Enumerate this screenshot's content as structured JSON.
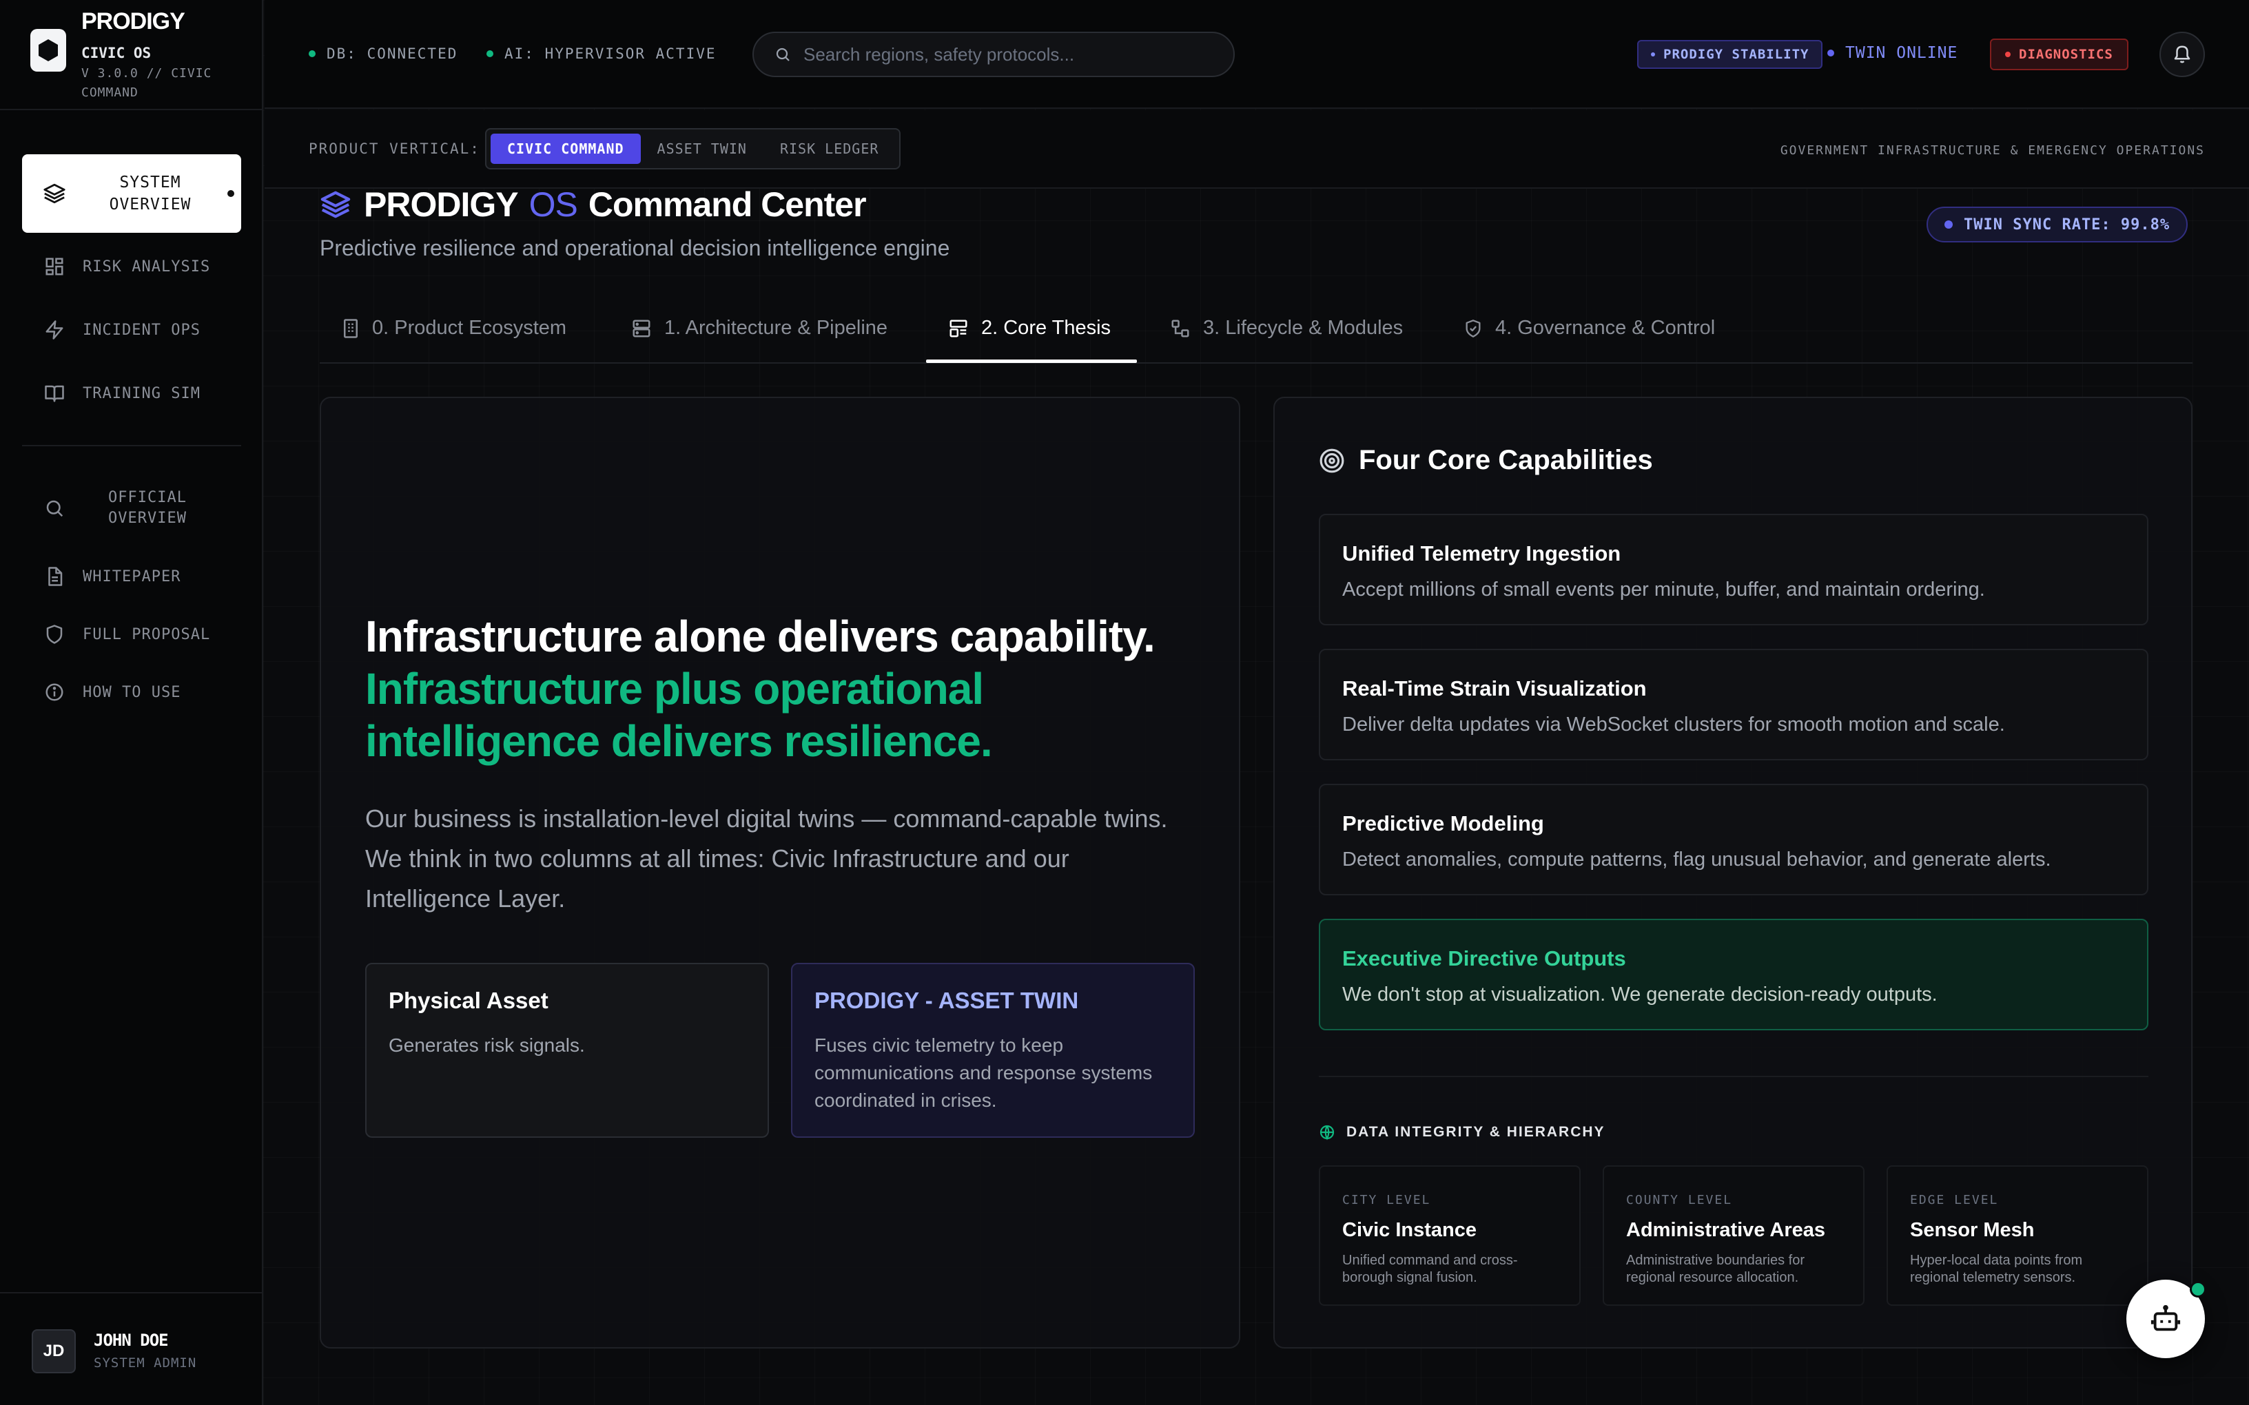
{
  "brand": {
    "name": "PRODIGY",
    "subtitle": "CIVIC OS",
    "version": "V 3.0.0 // CIVIC COMMAND"
  },
  "sidebar": {
    "active_item": {
      "label": "SYSTEM OVERVIEW",
      "icon": "layers-icon"
    },
    "items": [
      {
        "label": "RISK ANALYSIS",
        "icon": "grid-icon"
      },
      {
        "label": "INCIDENT OPS",
        "icon": "lightning-icon"
      },
      {
        "label": "TRAINING SIM",
        "icon": "book-icon"
      }
    ],
    "secondary_items": [
      {
        "label": "OFFICIAL OVERVIEW",
        "icon": "search-icon"
      },
      {
        "label": "WHITEPAPER",
        "icon": "document-icon"
      },
      {
        "label": "FULL PROPOSAL",
        "icon": "shield-icon"
      },
      {
        "label": "HOW TO USE",
        "icon": "info-icon"
      }
    ],
    "user": {
      "initials": "JD",
      "name": "JOHN DOE",
      "role": "SYSTEM ADMIN"
    }
  },
  "topbar": {
    "status_db": "DB: CONNECTED",
    "status_ai": "AI: HYPERVISOR ACTIVE",
    "search_placeholder": "Search regions, safety protocols...",
    "stability_label": "PRODIGY STABILITY",
    "twin_status": "TWIN ONLINE",
    "diagnostics_label": "DIAGNOSTICS",
    "colors": {
      "ok": "#10b981",
      "accent": "#6366f1",
      "danger": "#ef4444"
    }
  },
  "vertical_bar": {
    "label": "PRODUCT VERTICAL:",
    "options": [
      "CIVIC COMMAND",
      "ASSET TWIN",
      "RISK LEDGER"
    ],
    "selected": "CIVIC COMMAND",
    "context": "GOVERNMENT INFRASTRUCTURE & EMERGENCY OPERATIONS"
  },
  "header": {
    "title_brand": "PRODIGY",
    "title_os": "OS",
    "title_rest": "Command Center",
    "subtitle": "Predictive resilience and operational decision intelligence engine",
    "sync_rate": "TWIN SYNC RATE: 99.8%"
  },
  "tabs": [
    {
      "label": "0. Product Ecosystem",
      "icon": "building-icon"
    },
    {
      "label": "1. Architecture & Pipeline",
      "icon": "server-icon"
    },
    {
      "label": "2. Core Thesis",
      "icon": "layout-icon"
    },
    {
      "label": "3. Lifecycle & Modules",
      "icon": "workflow-icon"
    },
    {
      "label": "4. Governance & Control",
      "icon": "shield-check-icon"
    }
  ],
  "active_tab": "2. Core Thesis",
  "thesis": {
    "headline_white": "Infrastructure alone delivers capability.",
    "headline_green": "Infrastructure plus operational intelligence delivers resilience.",
    "body": "Our business is installation-level digital twins — command-capable twins. We think in two columns at all times: Civic Infrastructure and our Intelligence Layer.",
    "cards": [
      {
        "title": "Physical Asset",
        "text": "Generates risk signals."
      },
      {
        "title": "PRODIGY - ASSET TWIN",
        "text": "Fuses civic telemetry to keep communications and response systems coordinated in crises."
      }
    ]
  },
  "capabilities": {
    "title": "Four Core Capabilities",
    "items": [
      {
        "title": "Unified Telemetry Ingestion",
        "text": "Accept millions of small events per minute, buffer, and maintain ordering."
      },
      {
        "title": "Real-Time Strain Visualization",
        "text": "Deliver delta updates via WebSocket clusters for smooth motion and scale."
      },
      {
        "title": "Predictive Modeling",
        "text": "Detect anomalies, compute patterns, flag unusual behavior, and generate alerts."
      },
      {
        "title": "Executive Directive Outputs",
        "text": "We don't stop at visualization. We generate decision-ready outputs."
      }
    ],
    "integrity_title": "DATA INTEGRITY & HIERARCHY",
    "levels": [
      {
        "kicker": "CITY LEVEL",
        "title": "Civic Instance",
        "text": "Unified command and cross-borough signal fusion."
      },
      {
        "kicker": "COUNTY LEVEL",
        "title": "Administrative Areas",
        "text": "Administrative boundaries for regional resource allocation."
      },
      {
        "kicker": "EDGE LEVEL",
        "title": "Sensor Mesh",
        "text": "Hyper-local data points from regional telemetry sensors."
      }
    ]
  }
}
